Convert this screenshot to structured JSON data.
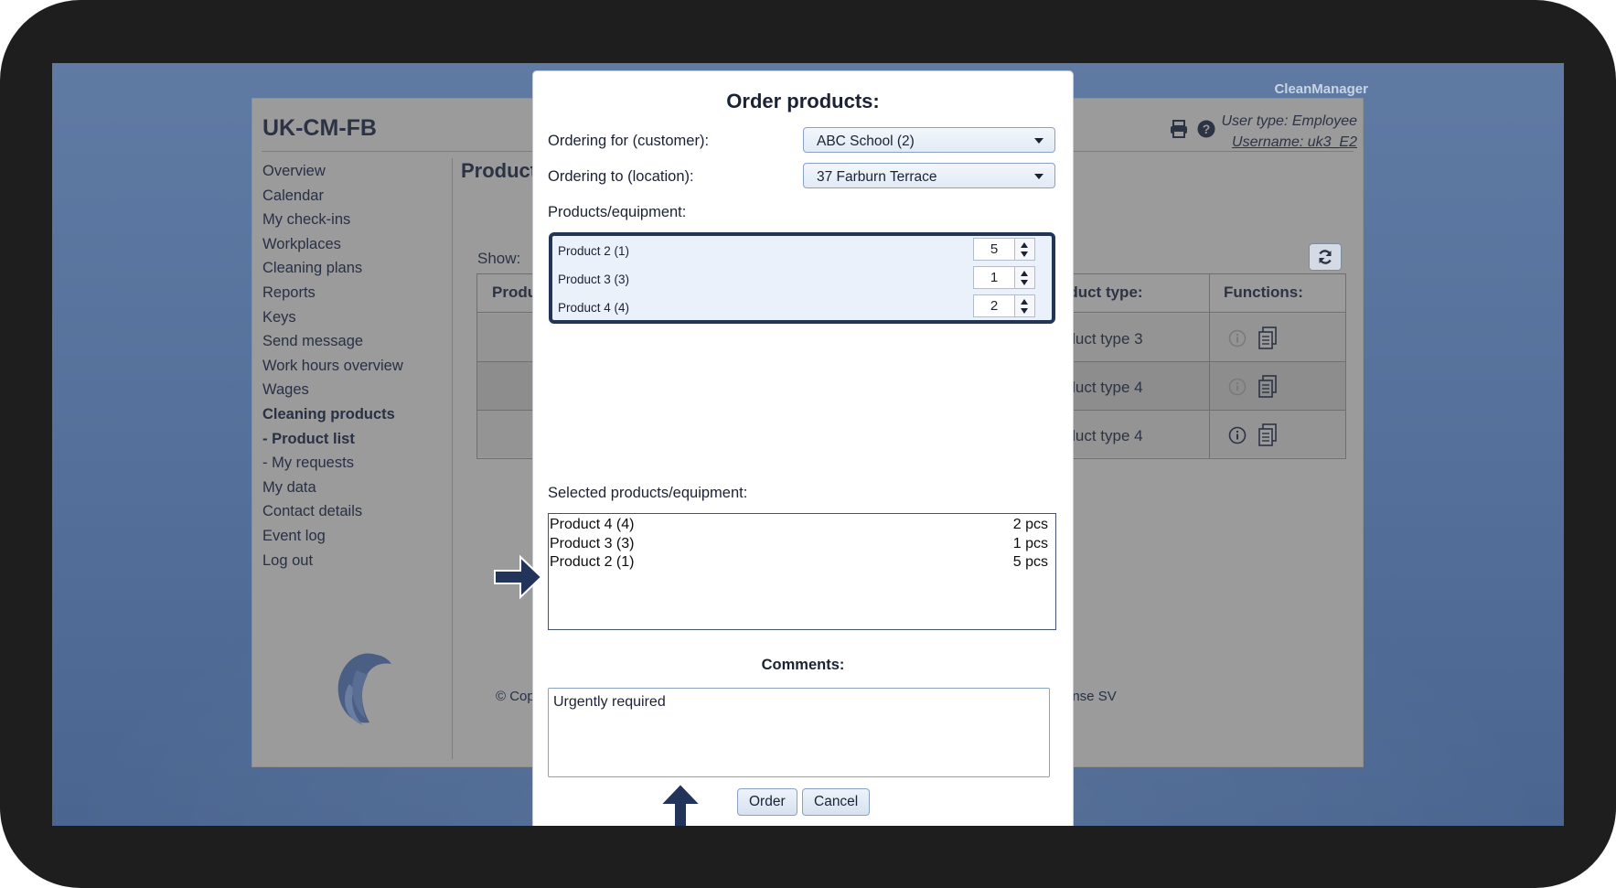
{
  "background": {
    "brand": "CleanManager",
    "app_title": "UK-CM-FB",
    "user_type": "User type: Employee",
    "username": "Username: uk3_E2",
    "page_heading": "Product",
    "show_label": "Show:",
    "nav": [
      {
        "label": "Overview",
        "bold": false
      },
      {
        "label": "Calendar",
        "bold": false
      },
      {
        "label": "My check-ins",
        "bold": false
      },
      {
        "label": "Workplaces",
        "bold": false
      },
      {
        "label": "Cleaning plans",
        "bold": false
      },
      {
        "label": "Reports",
        "bold": false
      },
      {
        "label": "Keys",
        "bold": false
      },
      {
        "label": "Send message",
        "bold": false
      },
      {
        "label": "Work hours overview",
        "bold": false
      },
      {
        "label": "Wages",
        "bold": false
      },
      {
        "label": "Cleaning products",
        "bold": true
      },
      {
        "label": "- Product list",
        "bold": true
      },
      {
        "label": "- My requests",
        "bold": false
      },
      {
        "label": "My data",
        "bold": false
      },
      {
        "label": "Contact details",
        "bold": false
      },
      {
        "label": "Event log",
        "bold": false
      },
      {
        "label": "Log out",
        "bold": false
      }
    ],
    "table": {
      "col_product": "Produ",
      "col_type": "Product type:",
      "col_functions": "Functions:",
      "rows": [
        "Product type 3",
        "Product type 4",
        "Product type 4"
      ]
    },
    "footer_left": "© Cop",
    "footer_right": "ense SV"
  },
  "modal": {
    "title": "Order products:",
    "customer_label": "Ordering for (customer):",
    "customer_value": "ABC School (2)",
    "location_label": "Ordering to (location):",
    "location_value": "37 Farburn Terrace",
    "products_label": "Products/equipment:",
    "products": [
      {
        "name": "Product 2 (1)",
        "qty": "5"
      },
      {
        "name": "Product 3 (3)",
        "qty": "1"
      },
      {
        "name": "Product 4 (4)",
        "qty": "2"
      }
    ],
    "selected_label": "Selected products/equipment:",
    "selected": [
      {
        "name": "Product 4 (4)",
        "qty": "2 pcs"
      },
      {
        "name": "Product 3 (3)",
        "qty": "1 pcs"
      },
      {
        "name": "Product 2 (1)",
        "qty": "5 pcs"
      }
    ],
    "comments_label": "Comments:",
    "comments_value": "Urgently required",
    "order_button": "Order",
    "cancel_button": "Cancel"
  },
  "colors": {
    "accent_dark": "#233556",
    "overlay_gray": "#9b9b9b",
    "background_blue": "#5f7aa3"
  },
  "icons": [
    "printer-icon",
    "help-icon",
    "refresh-icon",
    "info-icon",
    "document-icon",
    "right-arrow-icon",
    "up-arrow-icon",
    "logo-icon",
    "dropdown-caret-icon"
  ]
}
